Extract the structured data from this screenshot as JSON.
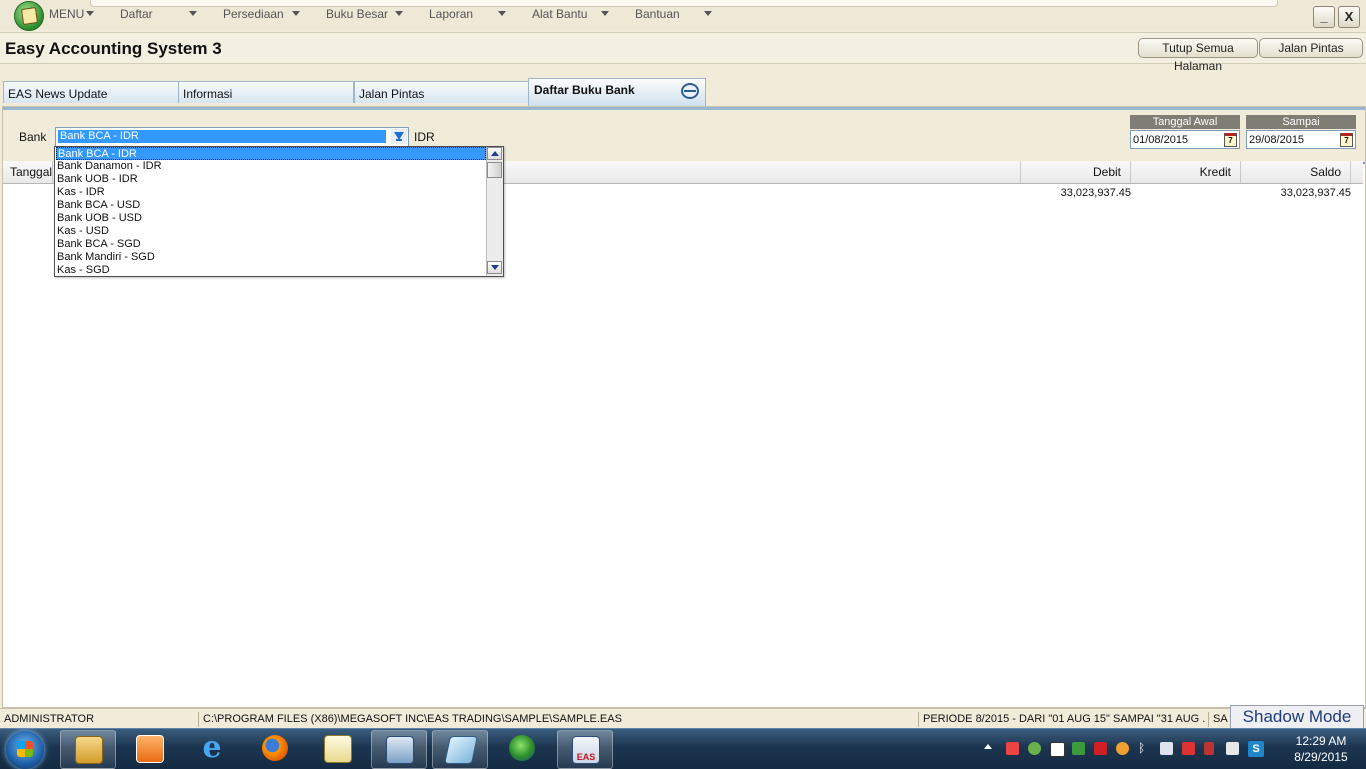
{
  "menubar": {
    "menu_label": "MENU",
    "items": [
      "Daftar",
      "Persediaan",
      "Buku Besar",
      "Laporan",
      "Alat Bantu",
      "Bantuan"
    ],
    "minimize_label": "_",
    "close_label": "X"
  },
  "titlebar": {
    "app_title": "Easy Accounting System 3",
    "close_all_label": "Tutup Semua Halaman",
    "shortcut_label": "Jalan Pintas"
  },
  "tabs": [
    {
      "label": "EAS News Update"
    },
    {
      "label": "Informasi"
    },
    {
      "label": "Jalan Pintas"
    },
    {
      "label": "Daftar Buku Bank",
      "active": true
    }
  ],
  "filter": {
    "bank_label": "Bank",
    "bank_selected": "Bank BCA - IDR",
    "currency": "IDR",
    "start_label": "Tanggal Awal",
    "start_value": "01/08/2015",
    "end_label": "Sampai",
    "end_value": "29/08/2015",
    "calendar_glyph": "7"
  },
  "dropdown": {
    "options": [
      "Bank BCA - IDR",
      "Bank Danamon - IDR",
      "Bank UOB - IDR",
      "Kas - IDR",
      "Bank BCA - USD",
      "Bank UOB - USD",
      "Kas - USD",
      "Bank BCA - SGD",
      "Bank Mandiri - SGD",
      "Kas - SGD"
    ],
    "selected_index": 0
  },
  "grid": {
    "columns": {
      "tanggal": "Tanggal",
      "debit": "Debit",
      "kredit": "Kredit",
      "saldo": "Saldo"
    },
    "rows": [
      {
        "debit": "33,023,937.45",
        "kredit": "",
        "saldo": "33,023,937.45"
      }
    ]
  },
  "statusbar": {
    "user": "ADMINISTRATOR",
    "path": "C:\\PROGRAM FILES (X86)\\MEGASOFT INC\\EAS TRADING\\SAMPLE\\SAMPLE.EAS",
    "period": "PERIODE 8/2015 - DARI \"01 AUG 15\" SAMPAI \"31 AUG ...",
    "extra": "SA",
    "shadow_mode": "Shadow Mode"
  },
  "taskbar": {
    "time": "12:29 AM",
    "date": "8/29/2015",
    "eas_label": "EAS",
    "icons": [
      "windows-start-icon",
      "file-explorer-icon",
      "media-player-icon",
      "internet-explorer-icon",
      "firefox-icon",
      "notepad-icon",
      "task-manager-icon",
      "app-icon",
      "globe-icon",
      "eas-app-icon"
    ]
  },
  "colors": {
    "accent": "#3399ff",
    "background": "#f1ecda",
    "taskbar": "#1c3550"
  }
}
